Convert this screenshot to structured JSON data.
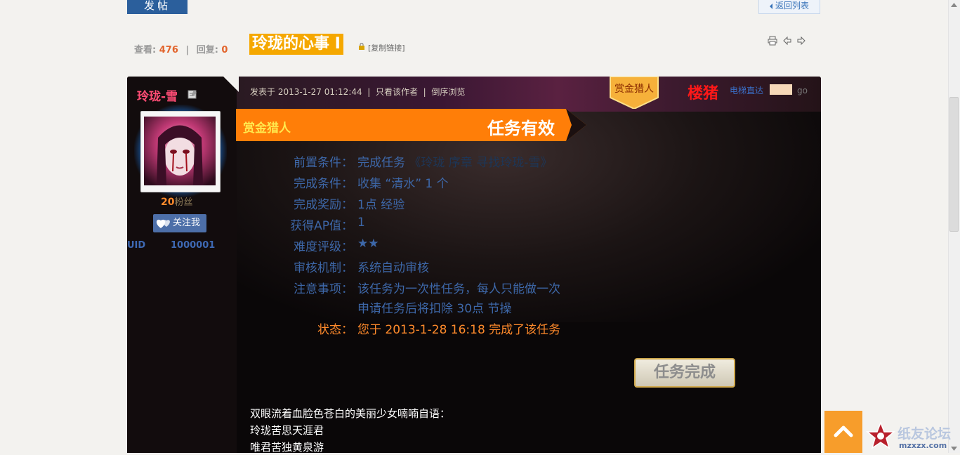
{
  "toolbar": {
    "post_button": "发帖",
    "back_to_list": "返回列表"
  },
  "thread": {
    "views_label": "查看:",
    "views": "476",
    "replies_label": "回复:",
    "replies": "0",
    "title": "玲珑的心事 I",
    "copy_link": "[复制链接]"
  },
  "author": {
    "name": "玲珑-雪",
    "fans_count": "20",
    "fans_label": "粉丝",
    "follow_button": "关注我",
    "uid_label": "UID",
    "uid": "1000001"
  },
  "post": {
    "posted_at": "发表于 2013-1-27 01:12:44",
    "only_author": "只看该作者",
    "reverse_browse": "倒序浏览",
    "bounty_badge": "赏金猎人",
    "floor_label": "楼猪",
    "elevator_label": "电梯直达",
    "elevator_go": "go"
  },
  "task": {
    "type": "赏金猎人",
    "status": "任务有效",
    "rows": [
      {
        "label": "前置条件：",
        "value": "完成任务",
        "value_dim": "《玲珑 序章 寻找玲珑-雪》"
      },
      {
        "label": "完成条件：",
        "value": "收集 “清水” 1 个"
      },
      {
        "label": "完成奖励：",
        "value": "1点 经验"
      },
      {
        "label": "获得AP值：",
        "value": "1"
      },
      {
        "label": "难度评级：",
        "value": "★★"
      },
      {
        "label": "审核机制：",
        "value": "系统自动审核"
      },
      {
        "label": "注意事项：",
        "value": "该任务为一次性任务，每人只能做一次"
      },
      {
        "label": "",
        "value": "申请任务后将扣除 30点 节操"
      },
      {
        "label": "状态：",
        "value": "您于 2013-1-28 16:18 完成了该任务"
      }
    ],
    "finish_button": "任务完成"
  },
  "content": {
    "lines": [
      "双眼流着血脸色苍白的美丽少女喃喃自语：",
      "玲珑苦思天涯君",
      "唯君苦独黄泉游"
    ]
  },
  "watermark": {
    "text": "纸友论坛",
    "sub": "mzxzx.com"
  },
  "colors": {
    "accent_orange": "#f5a800",
    "label_blue": "#3d67a8",
    "status_orange": "#ff8a2b",
    "post_bg": "#0a0708"
  }
}
